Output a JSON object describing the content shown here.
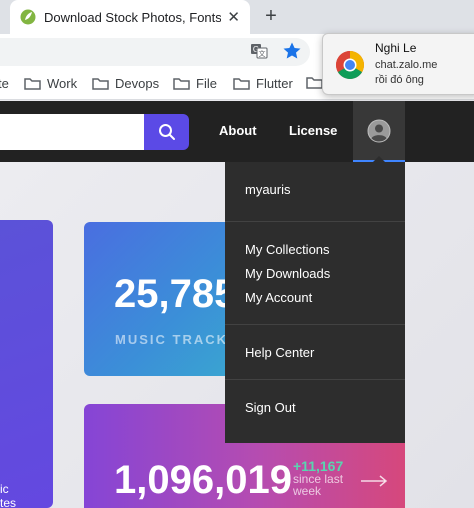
{
  "browser": {
    "tab": {
      "title": "Download Stock Photos, Fonts & Gr",
      "close": "✕"
    },
    "new_tab": "+",
    "bookmarks": [
      {
        "label": "te"
      },
      {
        "label": "Work"
      },
      {
        "label": "Devops"
      },
      {
        "label": "File"
      },
      {
        "label": "Flutter"
      },
      {
        "label": ""
      }
    ]
  },
  "notification": {
    "title": "Nghi Le",
    "source": "chat.zalo.me",
    "message": "rồi đó ông",
    "icon": "chrome-icon"
  },
  "header": {
    "search_value": "",
    "nav": {
      "about": "About",
      "license": "License"
    },
    "account_icon": "avatar-icon",
    "accent_color": "#5b4ae6"
  },
  "dropdown": {
    "username": "myauris",
    "items": [
      "My Collections",
      "My Downloads",
      "My Account"
    ],
    "help": "Help Center",
    "sign_out": "Sign Out"
  },
  "stats": {
    "left_card": {
      "line1": "ic",
      "line2": "tes"
    },
    "music": {
      "value": "25,785",
      "label": "MUSIC TRACKS"
    },
    "total": {
      "value": "1,096,019",
      "change": "+11,167",
      "since_line1": "since last",
      "since_line2": "week"
    }
  }
}
